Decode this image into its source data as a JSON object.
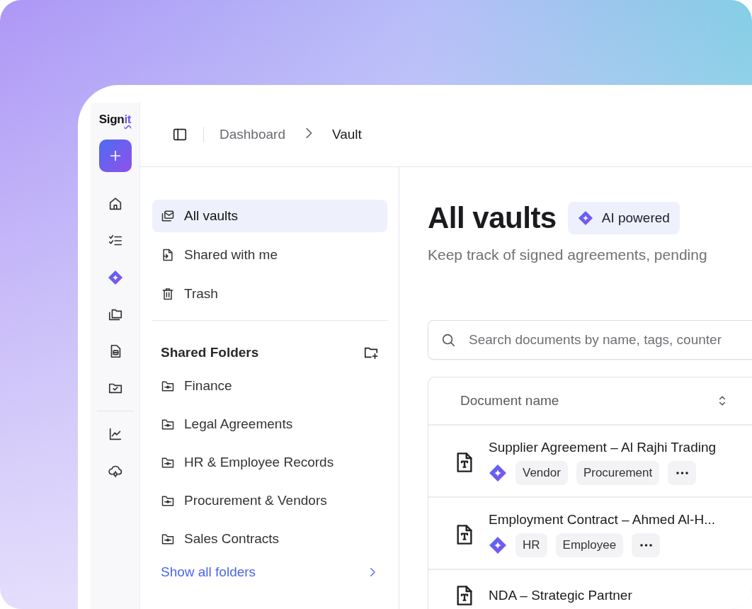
{
  "logo": {
    "text": "Sign",
    "accent": "it"
  },
  "rail": {
    "top": [
      {
        "kind": "home"
      },
      {
        "kind": "tasks"
      },
      {
        "kind": "ai"
      },
      {
        "kind": "folders"
      },
      {
        "kind": "document"
      },
      {
        "kind": "folder-check"
      }
    ],
    "bottom": [
      {
        "kind": "chart"
      },
      {
        "kind": "cloud-settings"
      }
    ]
  },
  "breadcrumb": [
    {
      "label": "Dashboard",
      "current": false
    },
    {
      "label": "Vault",
      "current": true
    }
  ],
  "nav": [
    {
      "label": "All vaults",
      "kind": "vault",
      "selected": true
    },
    {
      "label": "Shared with me",
      "kind": "shared",
      "selected": false
    },
    {
      "label": "Trash",
      "kind": "trash",
      "selected": false
    }
  ],
  "shared_folders": {
    "title": "Shared Folders",
    "folders": [
      "Finance",
      "Legal Agreements",
      "HR & Employee Records",
      "Procurement & Vendors",
      "Sales Contracts"
    ],
    "show_all": "Show all folders"
  },
  "content": {
    "title": "All vaults",
    "badge": "AI powered",
    "subtitle": "Keep track of signed agreements, pending",
    "search": {
      "placeholder": "Search documents by name, tags, counter"
    },
    "table": {
      "columns": [
        "Document name"
      ],
      "rows": [
        {
          "name": "Supplier Agreement – Al Rajhi Trading",
          "ai": true,
          "tags": [
            "Vendor",
            "Procurement"
          ],
          "more": true
        },
        {
          "name": "Employment Contract – Ahmed Al-H...",
          "ai": true,
          "tags": [
            "HR",
            "Employee"
          ],
          "more": true
        },
        {
          "name": "NDA – Strategic Partner"
        }
      ]
    }
  }
}
